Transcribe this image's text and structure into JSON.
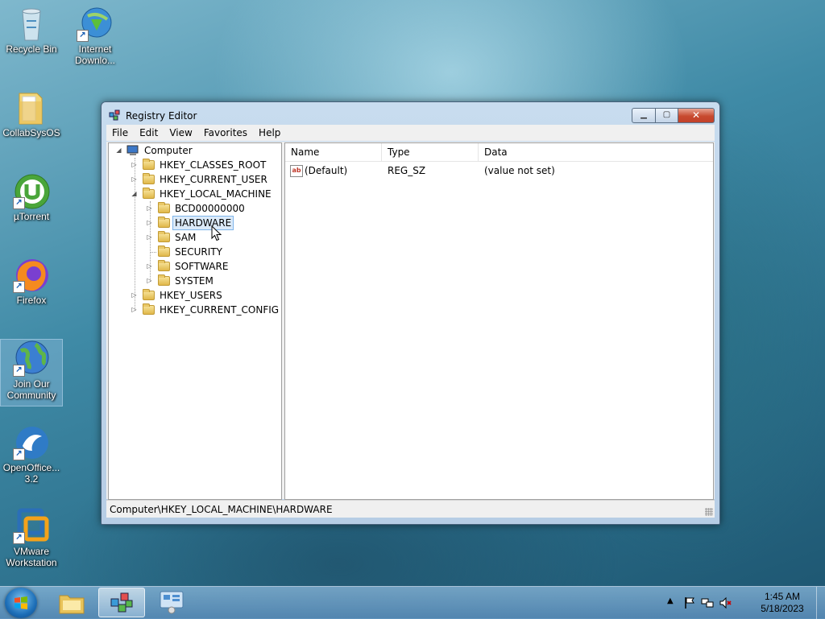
{
  "desktop": {
    "icons": [
      {
        "label": "Recycle Bin"
      },
      {
        "label": "Internet Downlo..."
      },
      {
        "label": "CollabSysOS"
      },
      {
        "label": "µTorrent"
      },
      {
        "label": "Firefox"
      },
      {
        "label": "Join Our Community"
      },
      {
        "label": "OpenOffice... 3.2"
      },
      {
        "label": "VMware Workstation"
      }
    ]
  },
  "window": {
    "title": "Registry Editor",
    "menu": [
      "File",
      "Edit",
      "View",
      "Favorites",
      "Help"
    ],
    "tree": {
      "root": "Computer",
      "hives": [
        "HKEY_CLASSES_ROOT",
        "HKEY_CURRENT_USER",
        "HKEY_LOCAL_MACHINE",
        "HKEY_USERS",
        "HKEY_CURRENT_CONFIG"
      ],
      "hklm_children": [
        "BCD00000000",
        "HARDWARE",
        "SAM",
        "SECURITY",
        "SOFTWARE",
        "SYSTEM"
      ],
      "selected": "HARDWARE"
    },
    "list": {
      "columns": [
        "Name",
        "Type",
        "Data"
      ],
      "rows": [
        {
          "name": "(Default)",
          "type": "REG_SZ",
          "data": "(value not set)"
        }
      ]
    },
    "status": "Computer\\HKEY_LOCAL_MACHINE\\HARDWARE"
  },
  "taskbar": {
    "time": "1:45 AM",
    "date": "5/18/2023"
  },
  "colors": {
    "selection": "#dbeaf9",
    "close_button": "#c74a2f"
  }
}
